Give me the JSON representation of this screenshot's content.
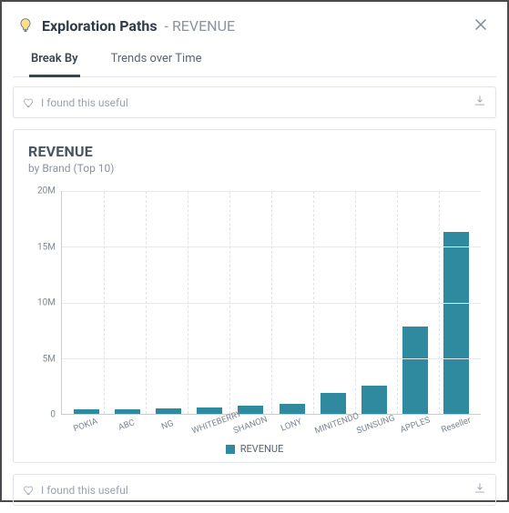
{
  "header": {
    "title_bold": "Exploration Paths",
    "title_suffix": " - REVENUE"
  },
  "tabs": {
    "break_by": "Break By",
    "trends": "Trends over Time"
  },
  "feedback": {
    "text": "I found this useful"
  },
  "chart_data": {
    "type": "bar",
    "title": "REVENUE",
    "subtitle": "by Brand (Top 10)",
    "xlabel": "",
    "ylabel": "",
    "ylim": [
      0,
      20000000
    ],
    "y_ticks": [
      "0",
      "5M",
      "10M",
      "15M",
      "20M"
    ],
    "categories": [
      "POKIA",
      "ABC",
      "NG",
      "WHITEBERRY",
      "SHANON",
      "LONY",
      "MINITENDO",
      "SUNSUNG",
      "APPLES",
      "Reseller"
    ],
    "values": [
      400000,
      450000,
      500000,
      550000,
      700000,
      900000,
      1900000,
      2500000,
      7800000,
      16300000
    ],
    "legend_label": "REVENUE",
    "series_color": "#2f8aa0"
  }
}
